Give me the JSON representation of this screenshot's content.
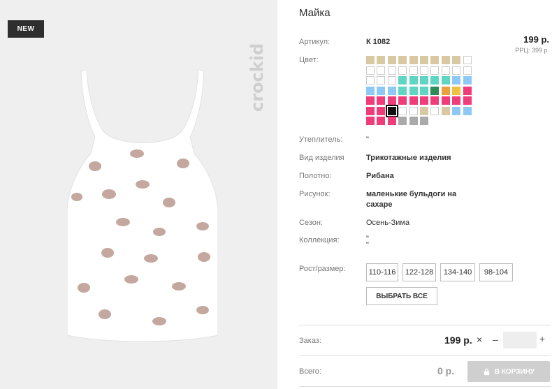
{
  "badge": "NEW",
  "brand": "crockid",
  "product": {
    "title": "Майка",
    "price": "199 р.",
    "rrp": "РРЦ: 399 р."
  },
  "specs": {
    "article_label": "Артикул:",
    "article_value": "К 1082",
    "color_label": "Цвет:",
    "insulation_label": "Утеплитель:",
    "insulation_value": "\"",
    "type_label": "Вид изделия",
    "type_value": "Трикотажные изделия",
    "fabric_label": "Полотно:",
    "fabric_value": "Рибана",
    "pattern_label": "Рисунок:",
    "pattern_value_1": "маленькие бульдоги на",
    "pattern_value_2": "сахаре",
    "season_label": "Сезон:",
    "season_value": "Осень-Зима",
    "collection_label": "Коллекция:",
    "collection_value_1": "\"",
    "collection_value_2": "\"",
    "size_label": "Рост/размер:"
  },
  "swatch_rows": [
    [
      "#d9c9a3",
      "#d9c9a3",
      "#d9c9a3",
      "#d9c9a3",
      "#d9c9a3",
      "#d9c9a3",
      "#d9c9a3",
      "#d9c9a3",
      "#d9c9a3",
      "#ffffff"
    ],
    [
      "#ffffff",
      "#ffffff",
      "#ffffff",
      "#ffffff",
      "#ffffff",
      "#ffffff",
      "#ffffff",
      "#ffffff",
      "#ffffff",
      "#ffffff"
    ],
    [
      "#ffffff",
      "#ffffff",
      "#ffffff",
      "#5ed6c3",
      "#5ed6c3",
      "#5ed6c3",
      "#5ed6c3",
      "#5ed6c3",
      "#8ec9f5",
      "#8ec9f5"
    ],
    [
      "#8ec9f5",
      "#8ec9f5",
      "#8ec9f5",
      "#5ed6c3",
      "#5ed6c3",
      "#5ed6c3",
      "#2e8b57",
      "#e8a040",
      "#f0c040",
      "#f03c78"
    ],
    [
      "#f03c78",
      "#f03c78",
      "#f03c78",
      "#f03c78",
      "#f03c78",
      "#f03c78",
      "#f03c78",
      "#f03c78",
      "#f03c78",
      "#f03c78"
    ],
    [
      "#f03c78",
      "#f03c78",
      "#111111",
      "#ffffff",
      "#ffffff",
      "#d9c9a3",
      "#ffffff",
      "#d9c9a3",
      "#8ec9f5",
      "#8ec9f5"
    ],
    [
      "#f03c78",
      "#f03c78",
      "#f03c78",
      "#aaaaaa",
      "#aaaaaa",
      "#aaaaaa"
    ]
  ],
  "selected_swatch": [
    5,
    2
  ],
  "sizes": [
    "110-116",
    "122-128",
    "134-140",
    "98-104"
  ],
  "select_all": "ВЫБРАТЬ ВСЕ",
  "order": {
    "order_label": "Заказ:",
    "order_price": "199 р.",
    "times": "×",
    "minus": "–",
    "plus": "+",
    "qty_value": "",
    "total_label": "Всего:",
    "total_value": "0 р.",
    "cart_button": "В КОРЗИНУ"
  },
  "accent": "#f03c78"
}
